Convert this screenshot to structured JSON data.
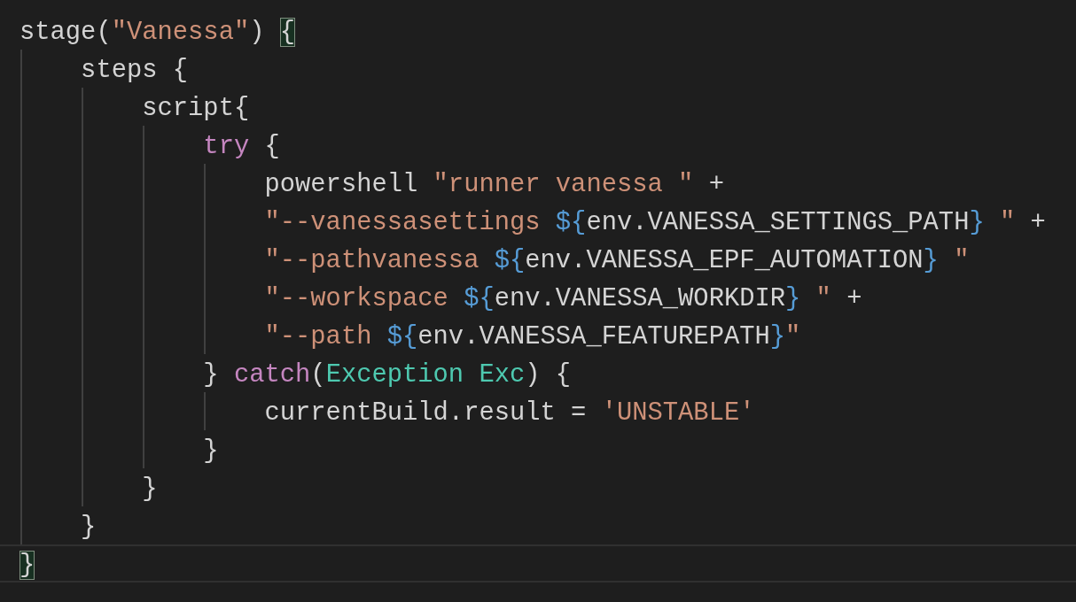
{
  "editor": {
    "lines": [
      {
        "current": false,
        "tokens": [
          {
            "kind": "plain",
            "text": "stage("
          },
          {
            "kind": "string",
            "text": "\"Vanessa\""
          },
          {
            "kind": "plain",
            "text": ") "
          },
          {
            "kind": "matched_bracket",
            "text": "{"
          }
        ]
      },
      {
        "current": false,
        "tokens": [
          {
            "kind": "plain",
            "text": "    steps {"
          }
        ]
      },
      {
        "current": false,
        "tokens": [
          {
            "kind": "plain",
            "text": "        script{"
          }
        ]
      },
      {
        "current": false,
        "tokens": [
          {
            "kind": "keyword",
            "text": "            try"
          },
          {
            "kind": "plain",
            "text": " {"
          }
        ]
      },
      {
        "current": false,
        "tokens": [
          {
            "kind": "plain",
            "text": "                powershell "
          },
          {
            "kind": "string",
            "text": "\"runner vanessa \""
          },
          {
            "kind": "plain",
            "text": " +"
          }
        ]
      },
      {
        "current": false,
        "tokens": [
          {
            "kind": "string",
            "text": "                \"--vanessasettings "
          },
          {
            "kind": "interp",
            "text": "${"
          },
          {
            "kind": "plain",
            "text": "env.VANESSA_SETTINGS_PATH"
          },
          {
            "kind": "interp",
            "text": "}"
          },
          {
            "kind": "string",
            "text": " \""
          },
          {
            "kind": "plain",
            "text": " +"
          }
        ]
      },
      {
        "current": false,
        "tokens": [
          {
            "kind": "string",
            "text": "                \"--pathvanessa "
          },
          {
            "kind": "interp",
            "text": "${"
          },
          {
            "kind": "plain",
            "text": "env.VANESSA_EPF_AUTOMATION"
          },
          {
            "kind": "interp",
            "text": "}"
          },
          {
            "kind": "string",
            "text": " \""
          }
        ]
      },
      {
        "current": false,
        "tokens": [
          {
            "kind": "string",
            "text": "                \"--workspace "
          },
          {
            "kind": "interp",
            "text": "${"
          },
          {
            "kind": "plain",
            "text": "env.VANESSA_WORKDIR"
          },
          {
            "kind": "interp",
            "text": "}"
          },
          {
            "kind": "string",
            "text": " \""
          },
          {
            "kind": "plain",
            "text": " +"
          }
        ]
      },
      {
        "current": false,
        "tokens": [
          {
            "kind": "string",
            "text": "                \"--path "
          },
          {
            "kind": "interp",
            "text": "${"
          },
          {
            "kind": "plain",
            "text": "env.VANESSA_FEATUREPATH"
          },
          {
            "kind": "interp",
            "text": "}"
          },
          {
            "kind": "string",
            "text": "\""
          }
        ]
      },
      {
        "current": false,
        "tokens": [
          {
            "kind": "plain",
            "text": "            } "
          },
          {
            "kind": "keyword",
            "text": "catch"
          },
          {
            "kind": "plain",
            "text": "("
          },
          {
            "kind": "type",
            "text": "Exception Exc"
          },
          {
            "kind": "plain",
            "text": ") {"
          }
        ]
      },
      {
        "current": false,
        "tokens": [
          {
            "kind": "plain",
            "text": "                currentBuild.result = "
          },
          {
            "kind": "string",
            "text": "'UNSTABLE'"
          }
        ]
      },
      {
        "current": false,
        "tokens": [
          {
            "kind": "plain",
            "text": "            }"
          }
        ]
      },
      {
        "current": false,
        "tokens": [
          {
            "kind": "plain",
            "text": "        }"
          }
        ]
      },
      {
        "current": false,
        "tokens": [
          {
            "kind": "plain",
            "text": "    }"
          }
        ]
      },
      {
        "current": true,
        "tokens": [
          {
            "kind": "matched_bracket",
            "text": "}"
          }
        ]
      }
    ]
  }
}
